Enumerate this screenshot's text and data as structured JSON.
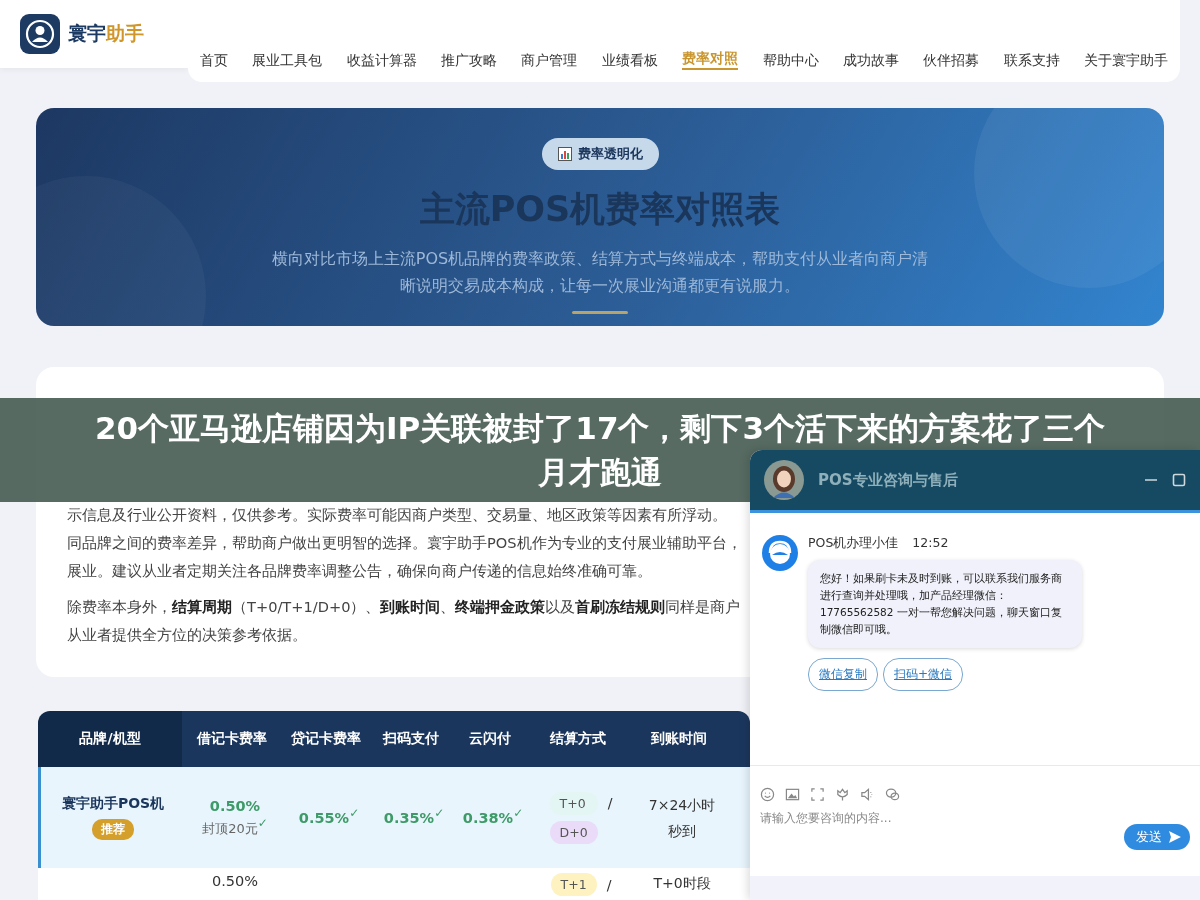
{
  "brand": {
    "name": "寰宇",
    "accent": "助手"
  },
  "nav": [
    {
      "label": "首页",
      "selected": false
    },
    {
      "label": "展业工具包",
      "selected": false
    },
    {
      "label": "收益计算器",
      "selected": false
    },
    {
      "label": "推广攻略",
      "selected": false
    },
    {
      "label": "商户管理",
      "selected": false
    },
    {
      "label": "业绩看板",
      "selected": false
    },
    {
      "label": "费率对照",
      "selected": true
    },
    {
      "label": "帮助中心",
      "selected": false
    },
    {
      "label": "成功故事",
      "selected": false
    },
    {
      "label": "伙伴招募",
      "selected": false
    },
    {
      "label": "联系支持",
      "selected": false
    },
    {
      "label": "关于寰宇助手",
      "selected": false
    }
  ],
  "hero": {
    "badge": "费率透明化",
    "title": "主流POS机费率对照表",
    "subtitle": "横向对比市场上主流POS机品牌的费率政策、结算方式与终端成本，帮助支付从业者向商户清晰说明交易成本构成，让每一次展业沟通都更有说服力。"
  },
  "intro": {
    "paragraphs": [
      [
        "示信息及行业公开资料，仅供参考。实际费率可能因商户类型、交易量、地区政策等因素有所浮动。",
        "同品牌之间的费率差异，帮助商户做出更明智的选择。寰宇助手POS机作为专业的支付展业辅助平台，",
        "展业。建议从业者定期关注各品牌费率调整公告，确保向商户传递的信息始终准确可靠。"
      ],
      [
        "除费率本身外，**结算周期**（T+0/T+1/D+0）、**到账时间**、**终端押金政策**以及**首刷冻结规则**同样是商户",
        "从业者提供全方位的决策参考依据。"
      ]
    ]
  },
  "table": {
    "columns": [
      "品牌/机型",
      "借记卡费率",
      "贷记卡费率",
      "扫码支付",
      "云闪付",
      "结算方式",
      "到账时间"
    ],
    "rows": [
      {
        "selected": true,
        "brand": "寰宇助手POS机",
        "badge": "推荐",
        "debit": {
          "rate": "0.50%",
          "cap": "封顶20元",
          "mark": "✓"
        },
        "credit": {
          "rate": "0.55%",
          "mark": "✓"
        },
        "scan": {
          "rate": "0.35%",
          "mark": "✓"
        },
        "unionpay": {
          "rate": "0.38%",
          "mark": "✓"
        },
        "settlement": [
          {
            "label": "T+0",
            "color": "#e3f6f3"
          },
          {
            "label": "D+0",
            "color": "#eadcf8"
          }
        ],
        "separator": "/",
        "arrival": [
          "7×24小时",
          "秒到"
        ]
      },
      {
        "selected": false,
        "debit": {
          "rate": "0.50%"
        },
        "settlement": [
          {
            "label": "T+1",
            "color": "#fdf2c0"
          }
        ],
        "separator": "/",
        "arrival": [
          "T+0时段"
        ]
      }
    ]
  },
  "banner": {
    "lines": [
      "20个亚马逊店铺因为IP关联被封了17个，剩下3个活下来的方案花了三个",
      "月才跑通"
    ]
  },
  "chat": {
    "title": "POS专业咨询与售后",
    "agent": "POS机办理小佳",
    "time": "12:52",
    "message": "您好！如果刷卡未及时到账，可以联系我们服务商进行查询并处理哦，加产品经理微信：17765562582 一对一帮您解决问题，聊天窗口复制微信即可哦。",
    "actions": [
      "微信复制",
      "扫码+微信"
    ],
    "placeholder": "请输入您要咨询的内容...",
    "send": "发送"
  }
}
